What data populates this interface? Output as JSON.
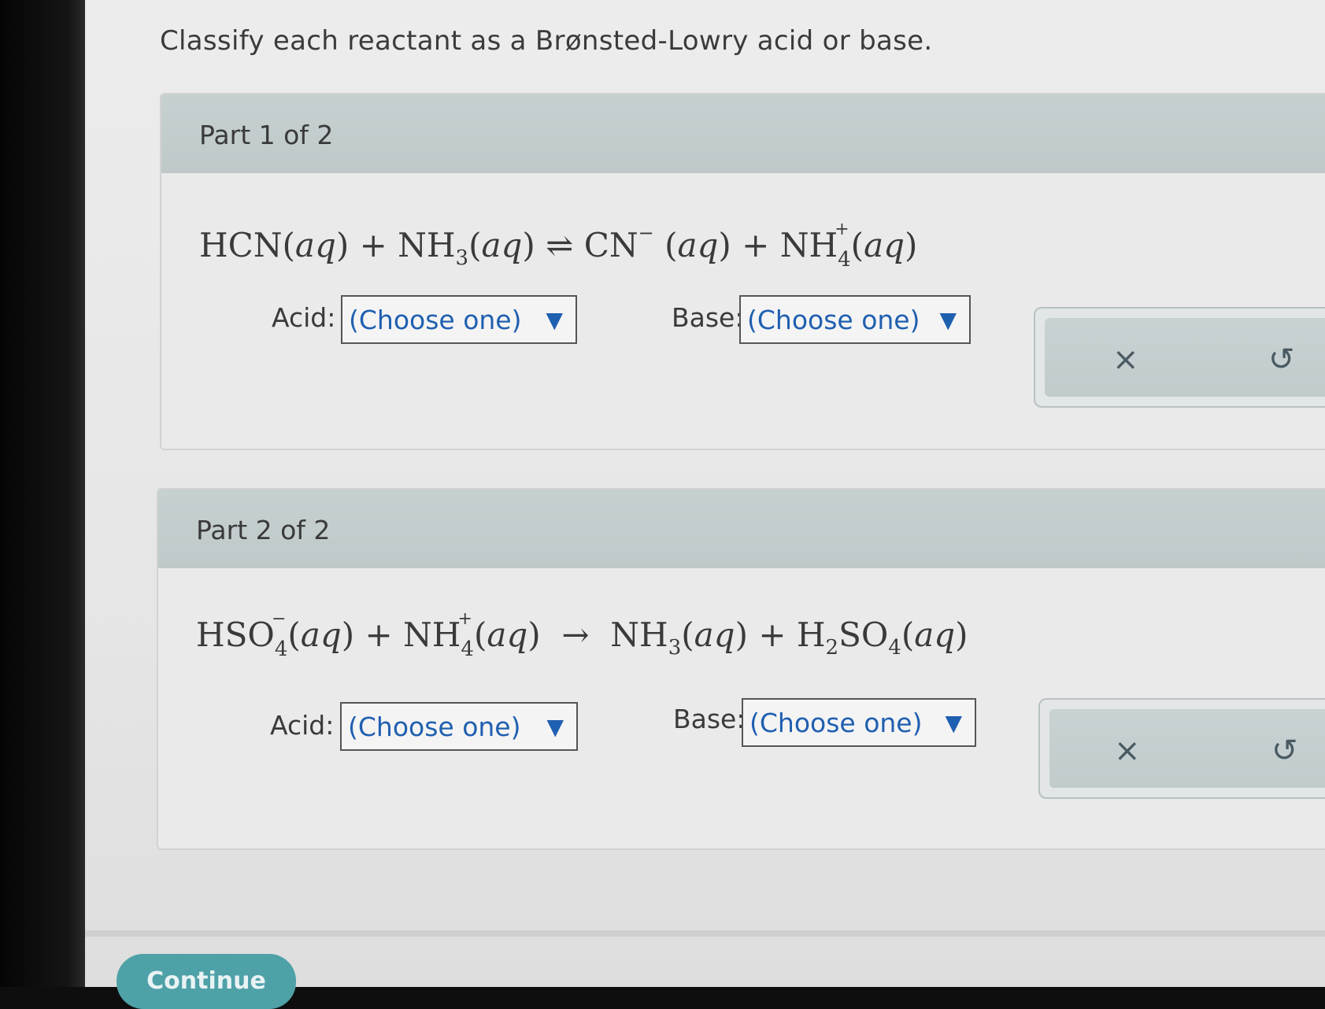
{
  "question": "Classify each reactant as a Brønsted-Lowry acid or base.",
  "parts": [
    {
      "title": "Part 1 of 2",
      "equation": {
        "hcn": "HCN",
        "aq": "aq",
        "nh3": "NH",
        "sub3": "3",
        "arrow": "⇌",
        "cn": "CN",
        "minus": "−",
        "nh4": "NH",
        "sub4": "4",
        "plus_charge": "+",
        "plus": "+"
      },
      "acid_label": "Acid:",
      "base_label": "Base:",
      "acid_value": "(Choose one)",
      "base_value": "(Choose one)"
    },
    {
      "title": "Part 2 of 2",
      "equation": {
        "hso": "HSO",
        "sub4": "4",
        "minus": "−",
        "aq": "aq",
        "nh4": "NH",
        "plus_charge": "+",
        "arrow": "→",
        "nh3": "NH",
        "sub3": "3",
        "h": "H",
        "sub2": "2",
        "so": "SO",
        "plus": "+"
      },
      "acid_label": "Acid:",
      "base_label": "Base:",
      "acid_value": "(Choose one)",
      "base_value": "(Choose one)"
    }
  ],
  "tools": {
    "clear_icon": "×",
    "undo_icon": "↺"
  },
  "dropdown_arrow": "▼",
  "continue_label": "Continue",
  "colors": {
    "header": "#c2cccd",
    "select_text": "#1f5fb0",
    "continue": "#4fa1a8"
  }
}
